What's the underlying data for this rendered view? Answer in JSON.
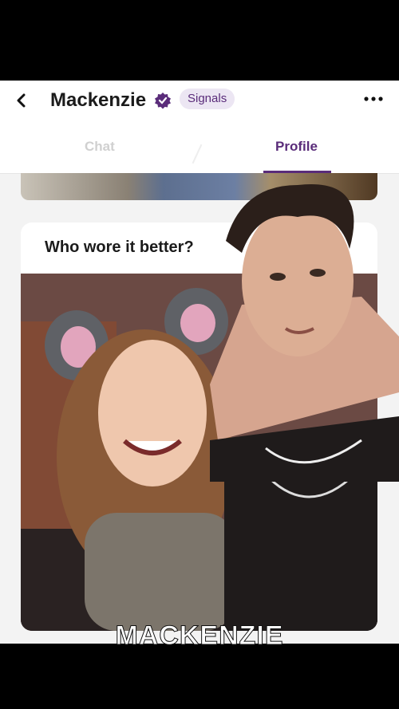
{
  "header": {
    "back_icon": "chevron-left-icon",
    "name": "Mackenzie",
    "verified_icon": "verified-badge-icon",
    "badge_label": "Signals",
    "more_icon": "more-options-icon"
  },
  "tabs": [
    {
      "label": "Chat",
      "active": false
    },
    {
      "label": "Profile",
      "active": true
    }
  ],
  "prompt_card": {
    "title": "Who wore it better?"
  },
  "caption": "MACKENZIE",
  "colors": {
    "accent": "#5a2c7a",
    "badge_bg": "#ece6f3",
    "app_bg": "#f3f3f3"
  }
}
